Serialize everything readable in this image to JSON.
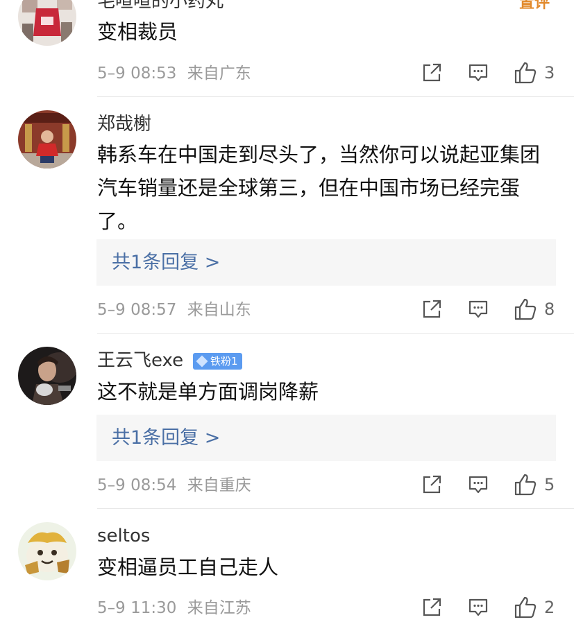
{
  "top_tag": "置评",
  "comments": [
    {
      "username": "毛喧喧的小药丸",
      "text": "变相裁员",
      "time": "5–9 08:53",
      "location": "来自广东",
      "likes": "3"
    },
    {
      "username": "郑哉榭",
      "text": "韩系车在中国走到尽头了，当然你可以说起亚集团汽车销量还是全球第三，但在中国市场已经完蛋了。",
      "reply": "共1条回复 >",
      "time": "5–9 08:57",
      "location": "来自山东",
      "likes": "8"
    },
    {
      "username": "王云飞exe",
      "badge": "铁粉1",
      "text": "这不就是单方面调岗降薪",
      "reply": "共1条回复 >",
      "time": "5–9 08:54",
      "location": "来自重庆",
      "likes": "5"
    },
    {
      "username": "seltos",
      "text": "变相逼员工自己走人",
      "time": "5–9 11:30",
      "location": "来自江苏",
      "likes": "2"
    }
  ],
  "icons": {
    "share": "share-icon",
    "comment": "comment-icon",
    "like": "thumbs-up-icon"
  },
  "colors": {
    "reply_link": "#4a6fa5",
    "meta_text": "#9a9a9a",
    "badge": "#5b9bf0"
  }
}
